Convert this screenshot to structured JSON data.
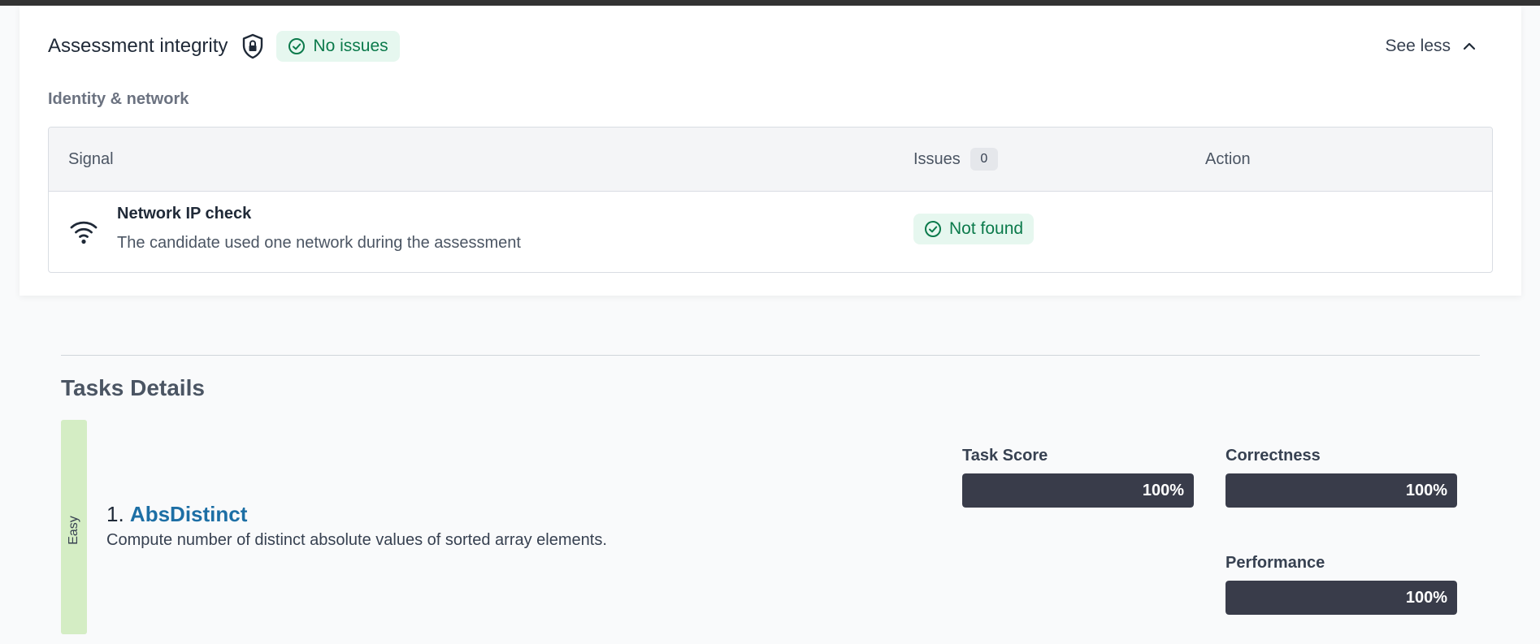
{
  "integrity": {
    "title": "Assessment integrity",
    "status_label": "No issues",
    "toggle_label": "See less",
    "subheading": "Identity & network",
    "table": {
      "headers": {
        "signal": "Signal",
        "issues": "Issues",
        "issues_count": "0",
        "action": "Action"
      },
      "rows": [
        {
          "icon": "wifi-icon",
          "title": "Network IP check",
          "description": "The candidate used one network during the assessment",
          "status": "Not found"
        }
      ]
    }
  },
  "tasks": {
    "section_title": "Tasks Details",
    "items": [
      {
        "difficulty": "Easy",
        "number": "1.",
        "name": "AbsDistinct",
        "description": "Compute number of distinct absolute values of sorted array elements.",
        "metrics": [
          {
            "label": "Task Score",
            "value": "100%",
            "fraction": 1.0
          },
          {
            "label": "Correctness",
            "value": "100%",
            "fraction": 1.0
          },
          {
            "label": "Performance",
            "value": "100%",
            "fraction": 1.0
          }
        ]
      }
    ]
  },
  "colors": {
    "success_bg": "#e6f7ef",
    "success_text": "#0b7a4b",
    "link": "#1d6fa5",
    "bar_fill": "#393c4a",
    "easy_strip": "#d4edc4"
  }
}
